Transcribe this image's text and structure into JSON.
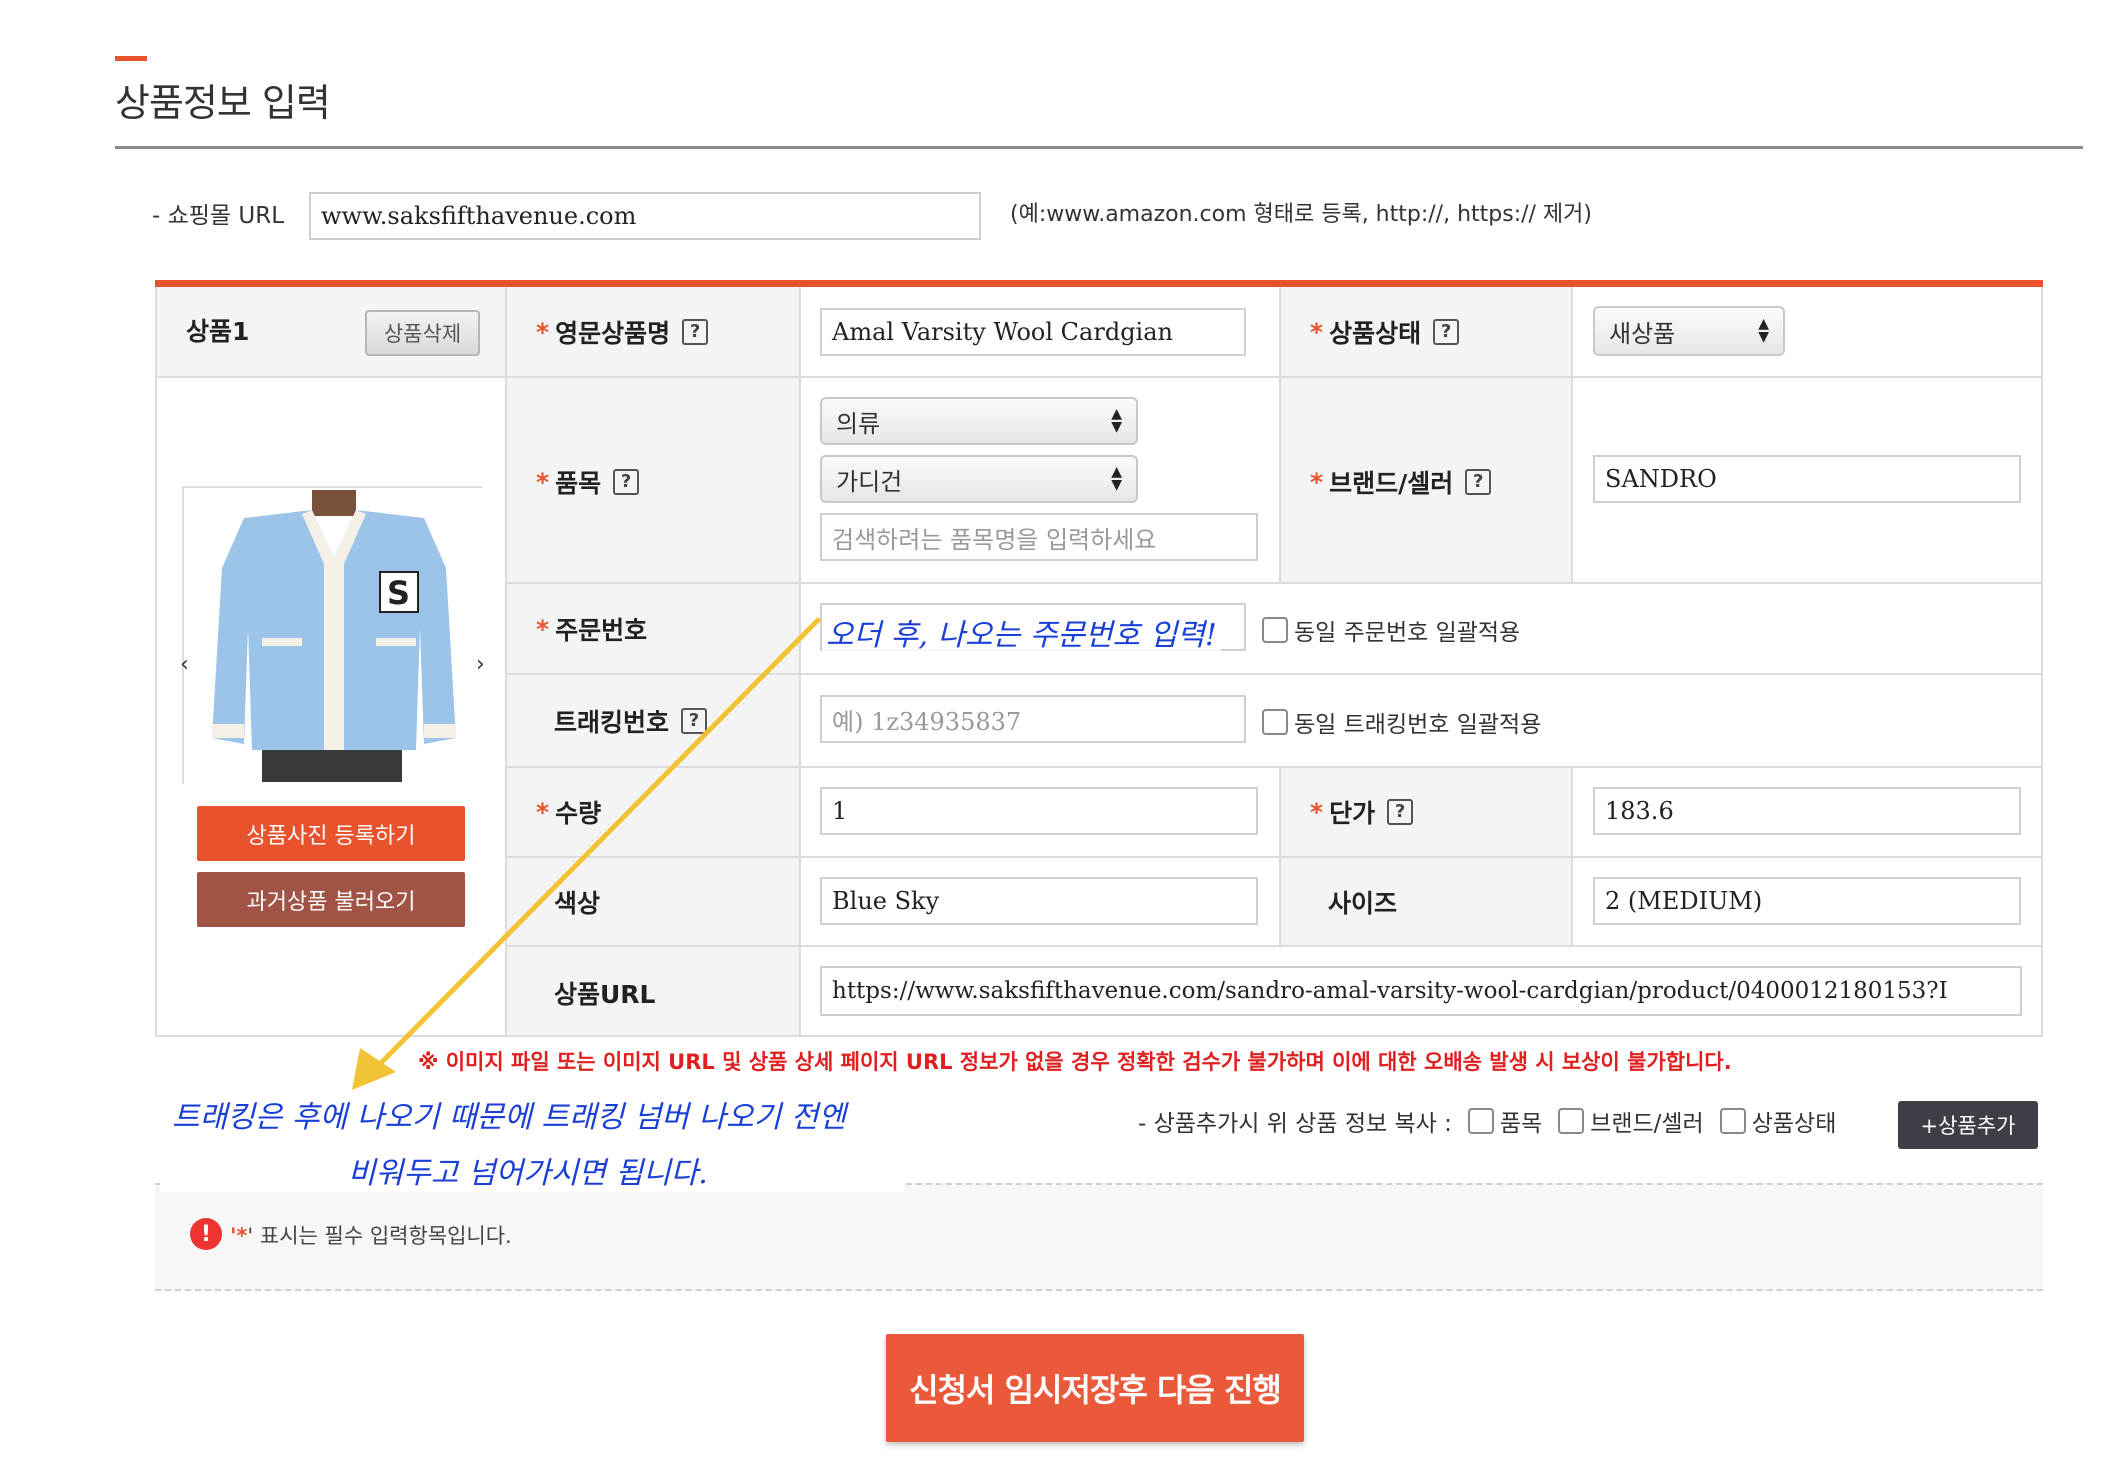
{
  "page": {
    "title": "상품정보 입력",
    "colors": {
      "accent": "#e8522c",
      "brown": "#a15346",
      "dark": "#3e3e46",
      "notice": "#e02020",
      "handwriting": "#1a3fd6",
      "arrow": "#f2c335"
    }
  },
  "shop_url": {
    "label": "- 쇼핑몰 URL",
    "value": "www.saksfifthavenue.com",
    "hint": "(예:www.amazon.com 형태로 등록, http://, https:// 제거)"
  },
  "product": {
    "header_label": "상품1",
    "delete_button": "상품삭제",
    "upload_photo_button": "상품사진 등록하기",
    "load_past_button": "과거상품 불러오기",
    "prev_arrow": "‹",
    "next_arrow": "›",
    "image_icon": "cardigan-photo",
    "fields": {
      "english_name": {
        "star": "*",
        "label": "영문상품명",
        "help": "?",
        "value": "Amal Varsity Wool Cardgian"
      },
      "condition": {
        "star": "*",
        "label": "상품상태",
        "help": "?",
        "value": "새상품"
      },
      "category": {
        "star": "*",
        "label": "품목",
        "help": "?",
        "main_value": "의류",
        "sub_value": "가디건",
        "search_placeholder": "검색하려는 품목명을 입력하세요"
      },
      "brand": {
        "star": "*",
        "label": "브랜드/셀러",
        "help": "?",
        "value": "SANDRO"
      },
      "order_number": {
        "star": "*",
        "label": "주문번호",
        "value": "",
        "bulk_label": "동일 주문번호 일괄적용"
      },
      "tracking_number": {
        "label": "트래킹번호",
        "help": "?",
        "placeholder": "예) 1z34935837",
        "bulk_label": "동일 트래킹번호 일괄적용"
      },
      "quantity": {
        "star": "*",
        "label": "수량",
        "value": "1"
      },
      "unit_price": {
        "star": "*",
        "label": "단가",
        "help": "?",
        "value": "183.6"
      },
      "color": {
        "label": "색상",
        "value": "Blue Sky"
      },
      "size": {
        "label": "사이즈",
        "value": "2 (MEDIUM)"
      },
      "product_url": {
        "label": "상품URL",
        "value": "https://www.saksfifthavenue.com/sandro-amal-varsity-wool-cardgian/product/0400012180153?I"
      }
    }
  },
  "notice": "※ 이미지 파일 또는 이미지 URL 및 상품 상세 페이지 URL 정보가 없을 경우 정확한 검수가 불가하며 이에 대한 오배송 발생 시 보상이 불가합니다.",
  "copy_row": {
    "label": "- 상품추가시 위 상품 정보 복사 :",
    "options": [
      "품목",
      "브랜드/셀러",
      "상품상태"
    ],
    "add_button": "+상품추가"
  },
  "annotations": {
    "order_note": "오더 후, 나오는 주문번호 입력!",
    "tracking_note_line1": "트래킹은 후에 나오기 때문에 트래킹 넘버 나오기 전엔",
    "tracking_note_line2": "비워두고 넘어가시면 됩니다."
  },
  "required_note": {
    "icon": "!",
    "star": "'*",
    "text": "' 표시는 필수 입력항목입니다."
  },
  "submit_button": "신청서 임시저장후 다음 진행"
}
